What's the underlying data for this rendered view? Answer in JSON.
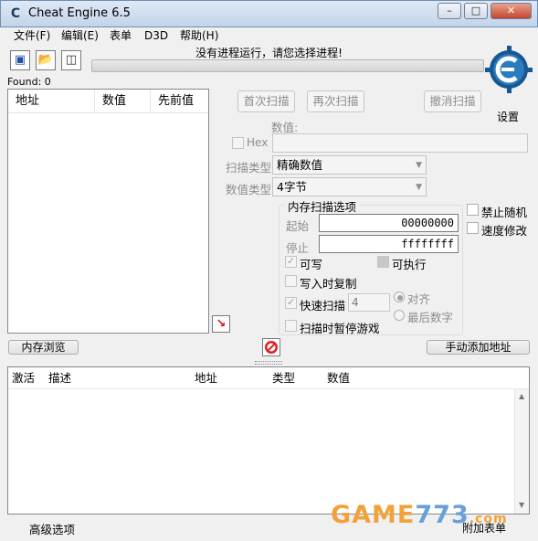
{
  "window": {
    "title": "Cheat Engine 6.5"
  },
  "menu": [
    "文件(F)",
    "编辑(E)",
    "表单",
    "D3D",
    "帮助(H)"
  ],
  "process_label": "没有进程运行，请您选择进程!",
  "found": "Found: 0",
  "logo_text": "Cheat Engine",
  "settings_label": "设置",
  "results_list": {
    "columns": [
      "地址",
      "数值",
      "先前值"
    ]
  },
  "scan": {
    "first_scan": "首次扫描",
    "next_scan": "再次扫描",
    "undo_scan": "撤消扫描",
    "value_label": "数值:",
    "hex_label": "Hex",
    "scan_type_label": "扫描类型",
    "scan_type_value": "精确数值",
    "value_type_label": "数值类型",
    "value_type_value": "4字节"
  },
  "memory_options": {
    "title": "内存扫描选项",
    "start_label": "起始",
    "start_value": "00000000",
    "stop_label": "停止",
    "stop_value": "ffffffff",
    "writable": "可写",
    "executable": "可执行",
    "copy_on_write": "写入时复制",
    "fast_scan": "快速扫描",
    "fast_scan_value": "4",
    "align": "对齐",
    "last_digits": "最后数字",
    "pause_game": "扫描时暂停游戏"
  },
  "right_options": {
    "no_random": "禁止随机",
    "speedhack": "速度修改"
  },
  "memory_view_button": "内存浏览",
  "add_address_button": "手动添加地址",
  "address_table": {
    "columns": [
      "激活",
      "描述",
      "地址",
      "类型",
      "数值"
    ]
  },
  "advanced_options": "高级选项",
  "table_extras": "附加表单",
  "watermark": {
    "part1": "GAME",
    "part2": "773",
    "part3": ".com"
  },
  "colors": {
    "title_bg": "#c8d8ec",
    "close_button": "#c4462d",
    "logo_blue": "#1c6aa6"
  }
}
